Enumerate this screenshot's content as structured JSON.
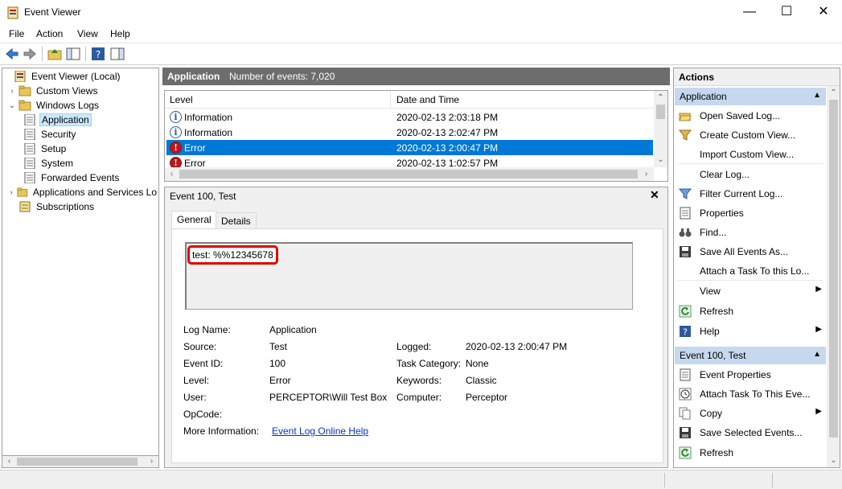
{
  "window": {
    "title": "Event Viewer",
    "minimize": "—",
    "maximize": "☐",
    "close": "✕"
  },
  "menu": [
    "File",
    "Action",
    "View",
    "Help"
  ],
  "tree": {
    "root": "Event Viewer (Local)",
    "custom_views": "Custom Views",
    "windows_logs": "Windows Logs",
    "application": "Application",
    "security": "Security",
    "setup": "Setup",
    "system": "System",
    "forwarded": "Forwarded Events",
    "apps_services": "Applications and Services Lo",
    "subscriptions": "Subscriptions"
  },
  "center": {
    "log_name": "Application",
    "count_label": "Number of events: 7,020",
    "col_level": "Level",
    "col_datetime": "Date and Time",
    "rows": [
      {
        "level": "Information",
        "datetime": "2020-02-13 2:03:18 PM",
        "type": "info"
      },
      {
        "level": "Information",
        "datetime": "2020-02-13 2:02:47 PM",
        "type": "info"
      },
      {
        "level": "Error",
        "datetime": "2020-02-13 2:00:47 PM",
        "type": "error"
      },
      {
        "level": "Error",
        "datetime": "2020-02-13 1:02:57 PM",
        "type": "error"
      }
    ]
  },
  "detail": {
    "title": "Event 100, Test",
    "tab_general": "General",
    "tab_details": "Details",
    "description": "test: %%12345678",
    "log_name_label": "Log Name:",
    "log_name": "Application",
    "source_label": "Source:",
    "source": "Test",
    "logged_label": "Logged:",
    "logged": "2020-02-13 2:00:47 PM",
    "event_id_label": "Event ID:",
    "event_id": "100",
    "task_label": "Task Category:",
    "task": "None",
    "level_label": "Level:",
    "level": "Error",
    "keywords_label": "Keywords:",
    "keywords": "Classic",
    "user_label": "User:",
    "user": "PERCEPTOR\\Will Test Box",
    "computer_label": "Computer:",
    "computer": "Perceptor",
    "opcode_label": "OpCode:",
    "opcode": "",
    "more_info_label": "More Information:",
    "more_info_link": "Event Log Online Help"
  },
  "actions": {
    "header": "Actions",
    "section1": "Application",
    "items1": [
      {
        "label": "Open Saved Log...",
        "icon": "folder-open-icon"
      },
      {
        "label": "Create Custom View...",
        "icon": "filter-icon"
      },
      {
        "label": "Import Custom View...",
        "icon": ""
      },
      {
        "label": "Clear Log...",
        "icon": ""
      },
      {
        "label": "Filter Current Log...",
        "icon": "filter-icon"
      },
      {
        "label": "Properties",
        "icon": "properties-icon"
      },
      {
        "label": "Find...",
        "icon": "binoculars-icon"
      },
      {
        "label": "Save All Events As...",
        "icon": "save-icon"
      },
      {
        "label": "Attach a Task To this Lo...",
        "icon": ""
      },
      {
        "label": "View",
        "icon": "",
        "submenu": true
      },
      {
        "label": "Refresh",
        "icon": "refresh-icon"
      },
      {
        "label": "Help",
        "icon": "help-icon",
        "submenu": true
      }
    ],
    "section2": "Event 100, Test",
    "items2": [
      {
        "label": "Event Properties",
        "icon": "properties-icon"
      },
      {
        "label": "Attach Task To This Eve...",
        "icon": "clock-icon"
      },
      {
        "label": "Copy",
        "icon": "copy-icon",
        "submenu": true
      },
      {
        "label": "Save Selected Events...",
        "icon": "save-icon"
      },
      {
        "label": "Refresh",
        "icon": "refresh-icon"
      }
    ]
  }
}
